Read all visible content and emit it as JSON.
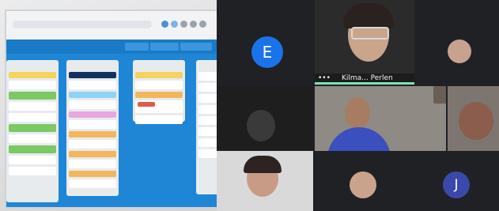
{
  "scene": {
    "description_colors": {
      "trello_background": "#1f86d6",
      "call_background": "#202124",
      "avatar_e": "#1a73e8",
      "avatar_j": "#3949ab"
    }
  },
  "trello": {
    "header_buttons": [
      "",
      "",
      ""
    ]
  },
  "call": {
    "participant_e": {
      "initial": "E"
    },
    "participant_j": {
      "initial": "J"
    },
    "speaker": {
      "name": "Kilma... Perlen",
      "menu": "•••"
    }
  }
}
